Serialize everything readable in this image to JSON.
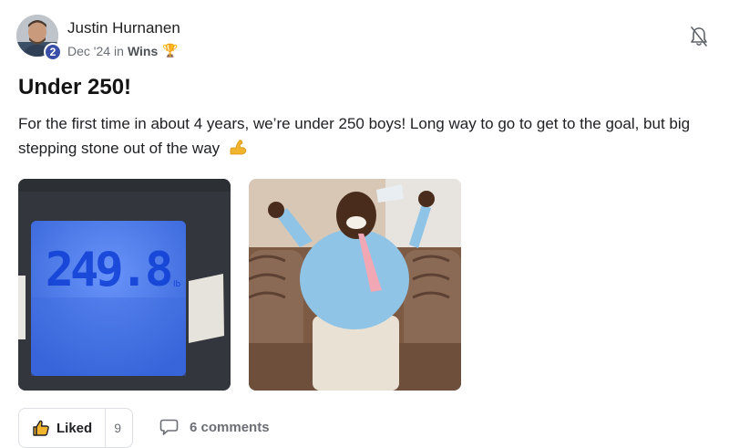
{
  "post": {
    "author": {
      "name": "Justin Hurnanen",
      "level": "2",
      "avatar_icon": "profile-photo"
    },
    "date": "Dec '24",
    "in_label": "in",
    "category": "Wins",
    "category_emoji": "🏆",
    "title": "Under 250!",
    "body_text": "For the first time in about 4 years, we’re under 250 boys! Long way to go to get to the goal, but big stepping stone out of the way",
    "body_emoji": "flexed-biceps-icon",
    "media": [
      {
        "kind": "scale-display-photo",
        "display_reading": "249.8",
        "unit": "lb"
      },
      {
        "kind": "celebration-dance-gif"
      }
    ],
    "actions": {
      "like_label": "Liked",
      "like_count": "9",
      "comments_label": "6 comments"
    },
    "icons": {
      "notifications": "bell-off-icon",
      "like": "thumbs-up-icon",
      "comments": "speech-bubble-icon"
    },
    "colors": {
      "level_badge": "#3a50a8",
      "scale_display": "#3d6fe0"
    }
  }
}
